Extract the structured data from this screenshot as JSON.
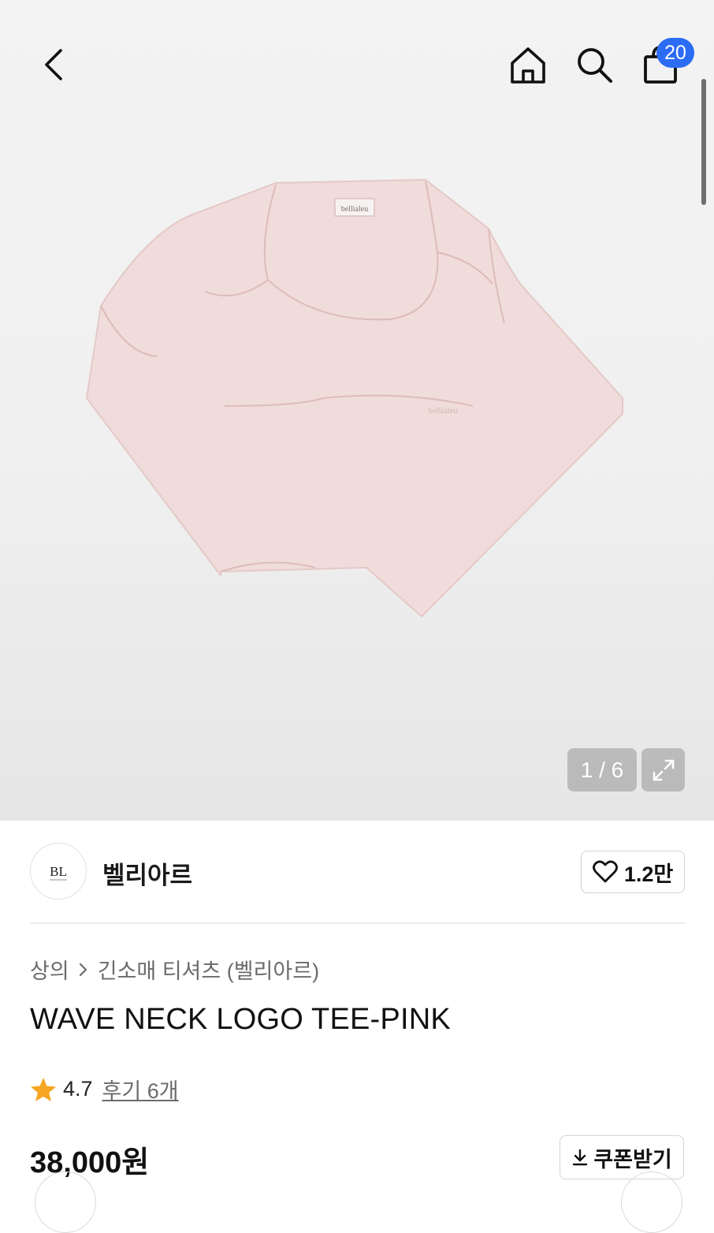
{
  "header": {
    "cart_count": "20",
    "icons": [
      "chevron-left-icon",
      "home-icon",
      "search-icon",
      "shopping-bag-icon"
    ]
  },
  "gallery": {
    "counter": "1 / 6",
    "garment_color": "#f0dcda",
    "tag_text": "bellialeu",
    "chest_logo_text": "bellialeu",
    "expand_icon": "expand-icon"
  },
  "brand": {
    "name": "벨리아르",
    "logo_text": "BL",
    "likes": "1.2만",
    "like_icon": "heart-outline-icon"
  },
  "breadcrumb": {
    "category": "상의",
    "subcategory": "긴소매 티셔츠 (벨리아르)"
  },
  "product": {
    "title": "WAVE NECK LOGO TEE-PINK",
    "rating": "4.7",
    "reviews": "후기 6개",
    "price": "38,000원"
  },
  "coupon": {
    "label": "쿠폰받기"
  },
  "colors": {
    "badge": "#2c6cf5",
    "star": "#f5a623"
  }
}
